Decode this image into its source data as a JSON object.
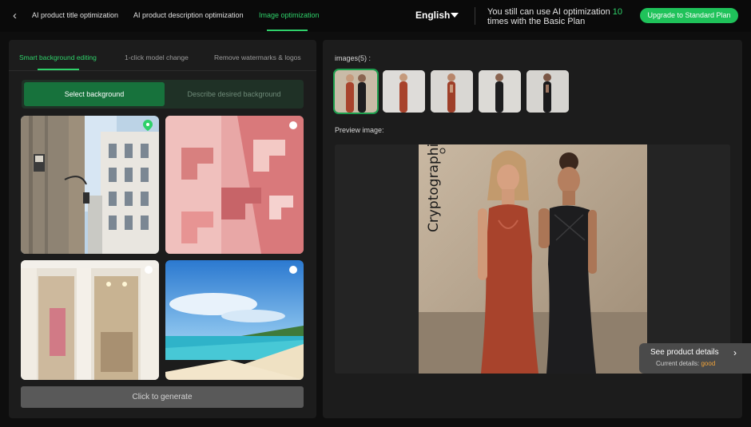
{
  "nav": {
    "back_icon": "chevron-left-icon",
    "tabs": [
      {
        "label": "AI product title optimization",
        "active": false
      },
      {
        "label": "AI product description optimization",
        "active": false
      },
      {
        "label": "Image optimization",
        "active": true
      }
    ],
    "language": "English",
    "quota_prefix": "You still can use AI optimization",
    "quota_count": "10",
    "quota_suffix": "times with the Basic Plan",
    "upgrade_label": "Upgrade to Standard Plan"
  },
  "left_panel": {
    "subtabs": [
      {
        "label": "Smart background editing",
        "active": true
      },
      {
        "label": "1-click model change",
        "active": false
      },
      {
        "label": "Remove watermarks & logos",
        "active": false
      }
    ],
    "segment": {
      "select_label": "Select background",
      "describe_label": "Describe desired background"
    },
    "backgrounds": [
      {
        "name": "paris-street",
        "selected": true
      },
      {
        "name": "pink-stairs",
        "selected": false
      },
      {
        "name": "white-storefront",
        "selected": false
      },
      {
        "name": "tropical-beach",
        "selected": false
      }
    ],
    "generate_label": "Click to generate"
  },
  "right_panel": {
    "images_label": "images(5) :",
    "preview_label": "Preview image:",
    "watermark_text": "Cryptographic",
    "thumbnails": [
      {
        "name": "two-models",
        "selected": true
      },
      {
        "name": "red-dress-front",
        "selected": false
      },
      {
        "name": "red-dress-back",
        "selected": false
      },
      {
        "name": "black-dress-front",
        "selected": false
      },
      {
        "name": "black-dress-back",
        "selected": false
      }
    ]
  },
  "details_card": {
    "title": "See product details",
    "sub_prefix": "Current details:",
    "sub_value": "good"
  },
  "colors": {
    "accent": "#2fd16a",
    "panel": "#1c1c1c",
    "background": "#0e0e0e",
    "good": "#f0a33a"
  }
}
